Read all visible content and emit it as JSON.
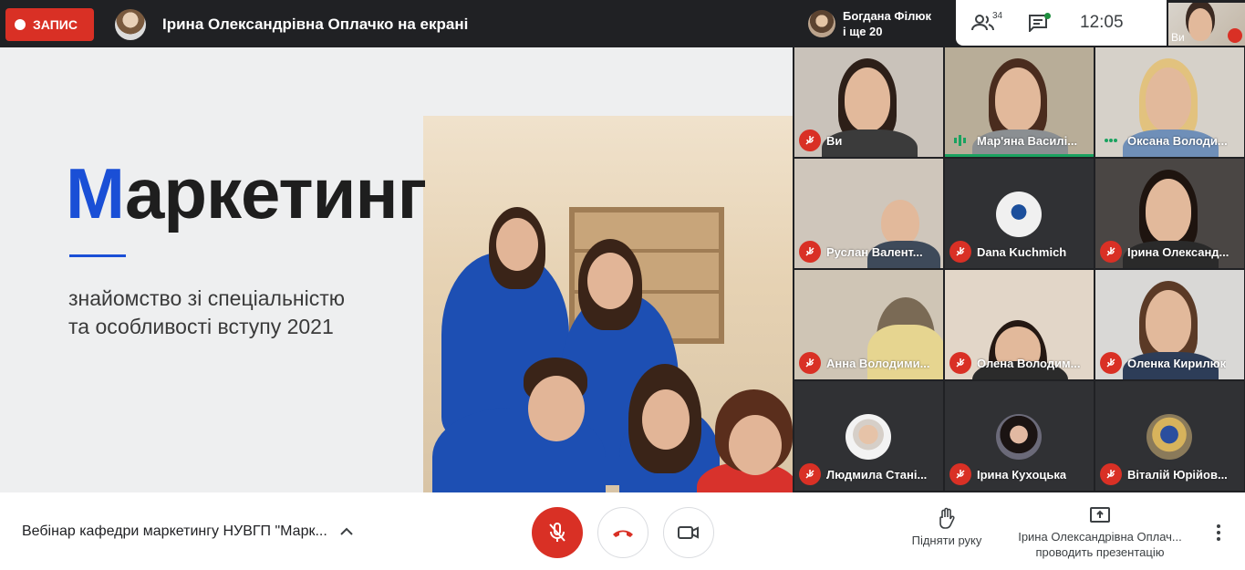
{
  "topbar": {
    "record_label": "ЗАПИС",
    "presenter_title": "Ірина Олександрівна Оплачко на екрані",
    "speaker_name": "Богдана Філюк",
    "speaker_more": "і ще 20",
    "participants_count": "34",
    "time": "12:05",
    "self_label": "Ви"
  },
  "slide": {
    "title_first": "М",
    "title_rest": "аркетинг",
    "subtitle_line1": "знайомство зі спеціальністю",
    "subtitle_line2": "та особливості вступу 2021"
  },
  "tiles": [
    {
      "name": "Ви",
      "status": "muted"
    },
    {
      "name": "Мар'яна Василі...",
      "status": "speaking"
    },
    {
      "name": "Оксана Володи...",
      "status": "dots"
    },
    {
      "name": "Руслан Валент...",
      "status": "muted"
    },
    {
      "name": "Dana Kuchmich",
      "status": "muted"
    },
    {
      "name": "Ірина Олександ...",
      "status": "muted"
    },
    {
      "name": "Анна Володими...",
      "status": "muted"
    },
    {
      "name": "Олена Володим...",
      "status": "muted"
    },
    {
      "name": "Оленка Кирилюк",
      "status": "muted"
    },
    {
      "name": "Людмила Стані...",
      "status": "muted"
    },
    {
      "name": "Ірина Кухоцька",
      "status": "muted"
    },
    {
      "name": "Віталій Юрійов...",
      "status": "muted"
    }
  ],
  "bottombar": {
    "meeting_title": "Вебінар кафедри маркетингу НУВГП \"Марк...",
    "raise_hand": "Підняти руку",
    "presenter_name": "Ірина Олександрівна Оплач...",
    "presenting_text": "проводить презентацію"
  },
  "colors": {
    "record_red": "#d93025",
    "brand_blue": "#1a4fd6",
    "speaking_green": "#1aa260",
    "dark_bg": "#202124"
  }
}
